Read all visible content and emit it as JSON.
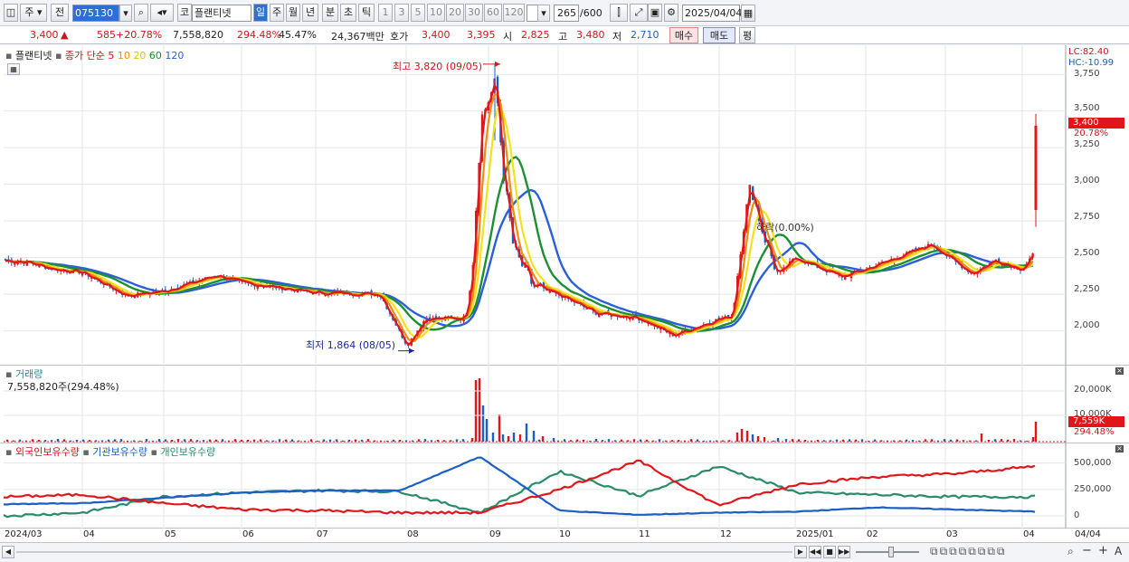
{
  "toolbar": {
    "market": "주",
    "prev": "전",
    "code": "075130",
    "name": "플랜티넷",
    "ind": "코",
    "period_tabs": [
      "일",
      "주",
      "월",
      "년",
      "분",
      "초",
      "틱"
    ],
    "minute_tabs": [
      "1",
      "3",
      "5",
      "10",
      "20",
      "30",
      "60",
      "120"
    ],
    "count": "265",
    "count_total": "/600",
    "date": "2025/04/04"
  },
  "quote": {
    "price": "3,400",
    "arrow": "▲",
    "change": "585",
    "rate": "+20.78%",
    "volume": "7,558,820",
    "vol_ratio": "294.48%",
    "turnover": "45.47%",
    "amount": "24,367백만",
    "hoga_label": "호가",
    "ask": "3,400",
    "bid": "3,395",
    "open_label": "시",
    "open": "2,825",
    "high_label": "고",
    "high": "3,480",
    "low_label": "저",
    "low": "2,710",
    "buy": "매수",
    "sell": "매도",
    "avg": "평"
  },
  "main_legend": {
    "name": "플랜티넷",
    "ma_label": "종가 단순",
    "ma": [
      "5",
      "10",
      "20",
      "60",
      "120"
    ]
  },
  "annotations": {
    "high": "최고 3,820 (09/05)",
    "low": "최저 1,864 (08/05)",
    "drop": "하락(0.00%)"
  },
  "price_axis": {
    "lc": "LC:82.40",
    "hc": "HC:-10.99",
    "ticks": [
      "3,750",
      "3,500",
      "3,400",
      "3,250",
      "3,000",
      "2,750",
      "2,500",
      "2,250",
      "2,000"
    ],
    "cur_price": "3,400",
    "cur_rate": "20.78%"
  },
  "volume_pane": {
    "title": "거래량",
    "value": "7,558,820주(294.48%)",
    "ticks": [
      "20,000K",
      "10,000K"
    ],
    "cur": "7,559K",
    "cur_rate": "294.48%"
  },
  "holdings_pane": {
    "legend": [
      "외국인보유수량",
      "기관보유수량",
      "개인보유수량"
    ],
    "ticks": [
      "500,000",
      "250,000",
      "0"
    ]
  },
  "x_axis": {
    "labels": [
      "2024/03",
      "04",
      "05",
      "06",
      "07",
      "08",
      "09",
      "10",
      "11",
      "12",
      "2025/01",
      "02",
      "03",
      "04"
    ],
    "last": "04/04"
  },
  "colors": {
    "up": "#e0161b",
    "down": "#1b5fc4",
    "ma5": "#e0161b",
    "ma10": "#f08c10",
    "ma20": "#f2e21c",
    "ma60": "#1d8f33",
    "ma120": "#2b5fd6"
  },
  "chart_data": [
    {
      "type": "line",
      "title": "플랜티넷",
      "x": [
        "2024/03",
        "04",
        "05",
        "06",
        "07",
        "08/05",
        "09/05",
        "10",
        "11",
        "12",
        "2025/01",
        "02",
        "03",
        "04/04"
      ],
      "series": [
        {
          "name": "종가",
          "values": [
            2500,
            2420,
            2300,
            2350,
            2280,
            1864,
            3820,
            2200,
            2050,
            2100,
            2450,
            2550,
            2500,
            3400
          ]
        }
      ],
      "ylim": [
        1800,
        3850
      ]
    },
    {
      "type": "bar",
      "title": "거래량",
      "x": [
        "04/04"
      ],
      "series": [
        {
          "name": "거래량",
          "values": [
            7558820
          ]
        }
      ]
    },
    {
      "type": "line",
      "title": "보유수량",
      "series": [
        {
          "name": "외국인보유수량",
          "values": [
            180000,
            200000,
            120000,
            60000,
            50000,
            30000,
            30000,
            250000,
            520000,
            100000,
            300000,
            370000,
            400000,
            470000
          ]
        },
        {
          "name": "기관보유수량",
          "values": [
            110000,
            120000,
            170000,
            220000,
            240000,
            240000,
            560000,
            50000,
            10000,
            30000,
            40000,
            80000,
            60000,
            40000
          ]
        },
        {
          "name": "개인보유수량",
          "values": [
            0,
            30000,
            180000,
            220000,
            240000,
            230000,
            30000,
            420000,
            190000,
            470000,
            220000,
            200000,
            180000,
            180000
          ]
        }
      ],
      "ylim": [
        0,
        600000
      ]
    }
  ]
}
